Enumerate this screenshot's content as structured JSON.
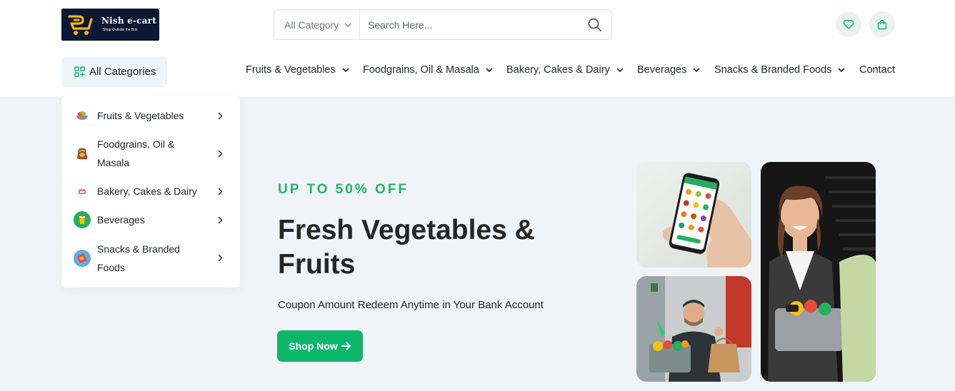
{
  "brand": {
    "name": "Nish e-cart",
    "tagline": "Shop Outside the Box"
  },
  "search": {
    "category": "All Category",
    "placeholder": "Search Here..."
  },
  "header_icons": [
    "heart-icon",
    "shopping-bag-icon"
  ],
  "all_categories_label": "All Categories",
  "nav": {
    "items": [
      {
        "label": "Fruits & Vegetables",
        "has_dropdown": true
      },
      {
        "label": "Foodgrains, Oil & Masala",
        "has_dropdown": true
      },
      {
        "label": "Bakery, Cakes & Dairy",
        "has_dropdown": true
      },
      {
        "label": "Beverages",
        "has_dropdown": true
      },
      {
        "label": "Snacks & Branded Foods",
        "has_dropdown": true
      },
      {
        "label": "Contact",
        "has_dropdown": false
      }
    ]
  },
  "dropdown": {
    "items": [
      {
        "line1": "Fruits & Vegetables",
        "line2": "",
        "icon": "vegetable-bowl-icon"
      },
      {
        "line1": "Foodgrains, Oil &",
        "line2": "Masala",
        "icon": "grain-sack-icon"
      },
      {
        "line1": "Bakery, Cakes & Dairy",
        "line2": "",
        "icon": "cake-icon"
      },
      {
        "line1": "Beverages",
        "line2": "",
        "icon": "juice-icon"
      },
      {
        "line1": "Snacks & Branded",
        "line2": "Foods",
        "icon": "snacks-icon"
      }
    ]
  },
  "hero": {
    "eyebrow": "UP TO 50% OFF",
    "title_line1": "Fresh Vegetables &",
    "title_line2": "Fruits",
    "subtitle": "Coupon Amount Redeem Anytime in Your Bank Account",
    "button_label": "Shop Now"
  },
  "colors": {
    "accent": "#0db66b",
    "eyebrow": "#1fb866",
    "hero_bg": "#f0f3f7",
    "logo_bg": "#0b1733",
    "logo_gold": "#f2b705"
  }
}
